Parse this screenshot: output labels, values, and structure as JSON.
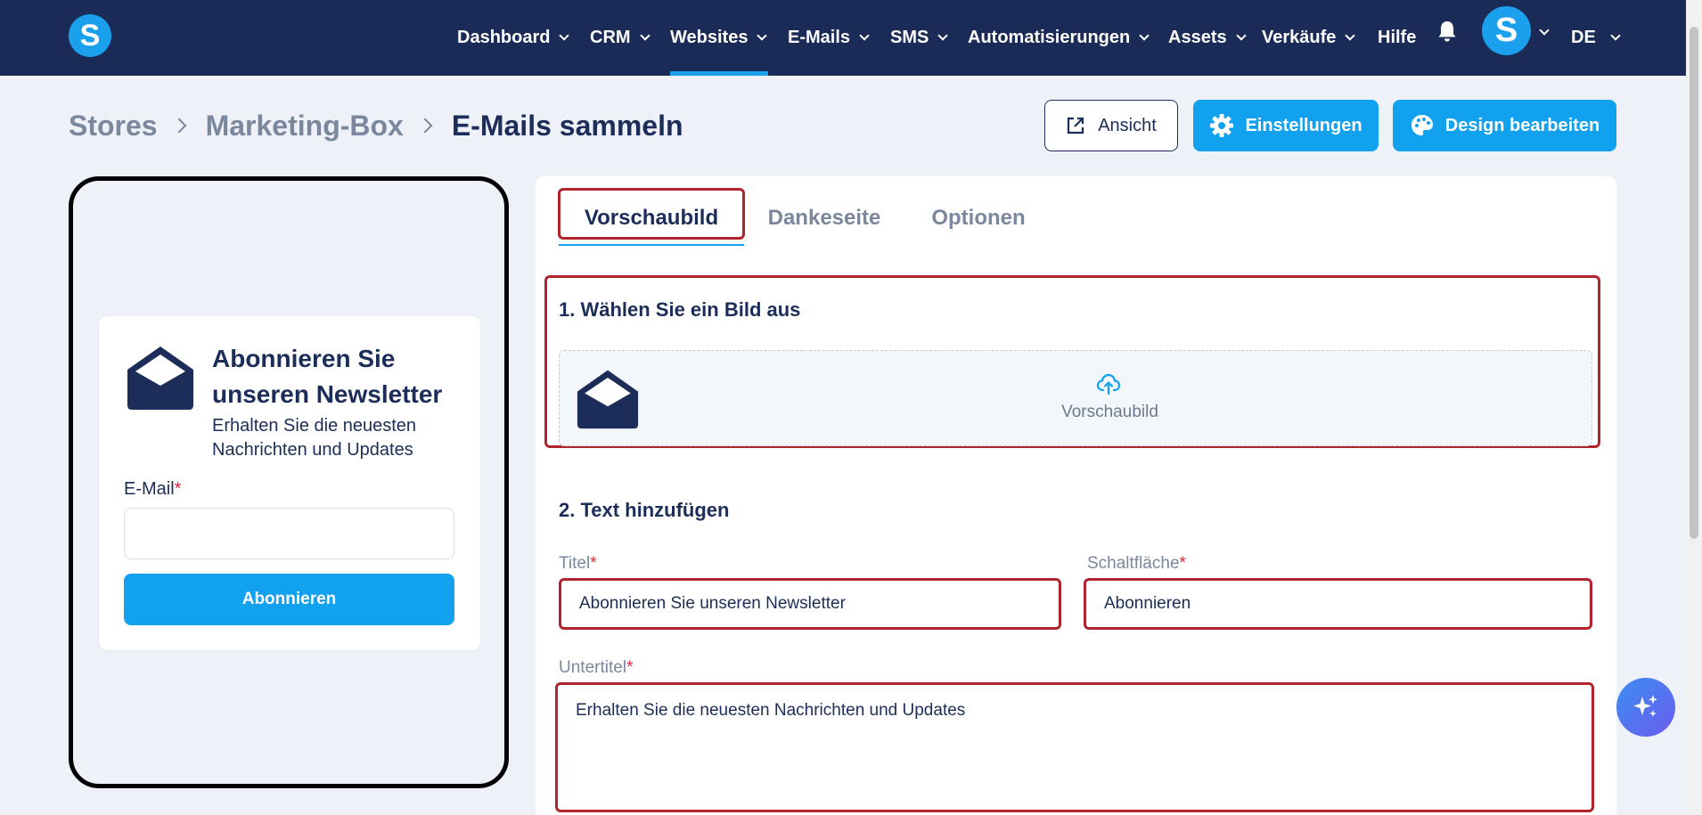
{
  "app": {
    "logo_letter": "S"
  },
  "nav": {
    "items": [
      {
        "label": "Dashboard",
        "has_menu": true
      },
      {
        "label": "CRM",
        "has_menu": true
      },
      {
        "label": "Websites",
        "has_menu": true,
        "active": true
      },
      {
        "label": "E-Mails",
        "has_menu": true
      },
      {
        "label": "SMS",
        "has_menu": true
      },
      {
        "label": "Automatisierungen",
        "has_menu": true
      },
      {
        "label": "Assets",
        "has_menu": true
      },
      {
        "label": "Verkäufe",
        "has_menu": true
      },
      {
        "label": "Hilfe",
        "has_menu": false
      }
    ],
    "avatar_letter": "S",
    "language": "DE",
    "accent": "#1aa0ec",
    "background": "#1a2b57"
  },
  "breadcrumb": {
    "items": [
      "Stores",
      "Marketing-Box"
    ],
    "current": "E-Mails sammeln"
  },
  "header_buttons": {
    "view": "Ansicht",
    "settings": "Einstellungen",
    "design": "Design bearbeiten"
  },
  "preview_card": {
    "title": "Abonnieren Sie unseren Newsletter",
    "subtitle": "Erhalten Sie die neuesten Nachrichten und Updates",
    "email_label": "E-Mail",
    "required_mark": "*",
    "email_value": "",
    "button": "Abonnieren"
  },
  "tabs": [
    {
      "label": "Vorschaubild",
      "active": true
    },
    {
      "label": "Dankeseite",
      "active": false
    },
    {
      "label": "Optionen",
      "active": false
    }
  ],
  "section_image": {
    "heading": "1. Wählen Sie ein Bild aus",
    "upload_label": "Vorschaubild"
  },
  "section_text": {
    "heading": "2. Text hinzufügen",
    "title_label": "Titel",
    "title_value": "Abonnieren Sie unseren Newsletter",
    "button_label": "Schaltfläche",
    "button_value": "Abonnieren",
    "subtitle_label": "Untertitel",
    "subtitle_value": "Erhalten Sie die neuesten Nachrichten und Updates",
    "required_mark": "*"
  },
  "colors": {
    "primary": "#12a1ee",
    "highlight": "#b0242e",
    "required": "#e0243c",
    "text": "#1b2d58",
    "muted": "#7a879d"
  }
}
